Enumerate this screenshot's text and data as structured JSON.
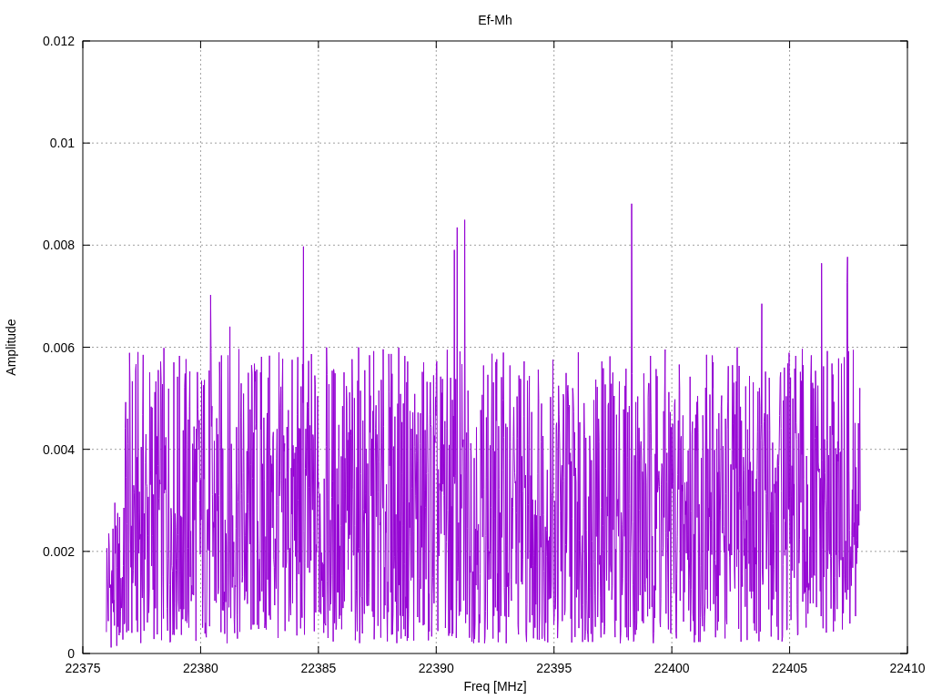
{
  "title": "Ef-Mh",
  "xlabel": "Freq [MHz]",
  "ylabel": "Amplitude",
  "xticks": [
    "22375",
    "22380",
    "22385",
    "22390",
    "22395",
    "22400",
    "22405",
    "22410"
  ],
  "yticks": [
    "0.012",
    "0.01",
    "0.008",
    "0.006",
    "0.004",
    "0.002",
    "0"
  ]
}
